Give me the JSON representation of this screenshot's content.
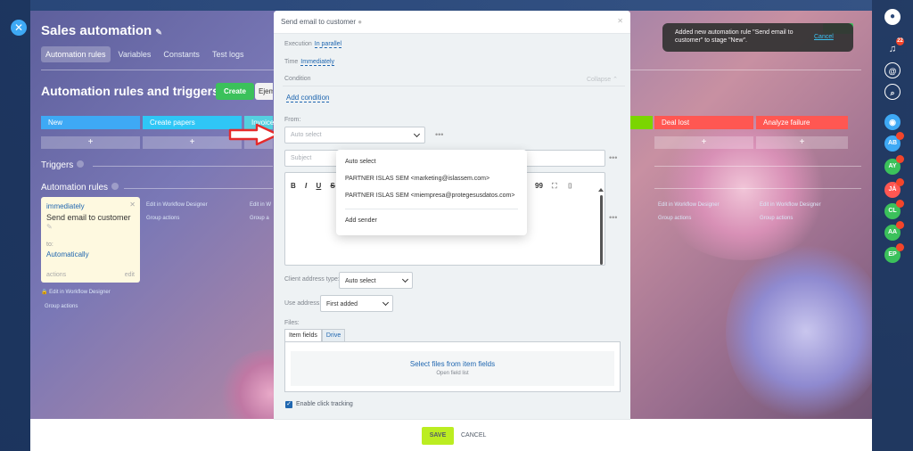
{
  "panel": {
    "title": "Sales automation",
    "tabs": [
      "Automation rules",
      "Variables",
      "Constants",
      "Test logs"
    ],
    "section_title": "Automation rules and triggers",
    "create_label": "Create",
    "ejem_label": "Ejem",
    "stages": [
      {
        "label": "New",
        "color": "#3ea9f5"
      },
      {
        "label": "Create papers",
        "color": "#2fc6f6"
      },
      {
        "label": "Invoice",
        "color": "#55d0e0"
      },
      {
        "label": "",
        "color": "#7bd500"
      },
      {
        "label": "Deal lost",
        "color": "#ff5752"
      },
      {
        "label": "Analyze failure",
        "color": "#ff5752"
      }
    ],
    "plus": "+",
    "triggers_label": "Triggers",
    "rules_label": "Automation rules",
    "rule_card": {
      "when": "immediately",
      "name": "Send email to customer",
      "to_label": "to:",
      "to_value": "Automatically",
      "foot_left": "actions",
      "foot_right": "edit"
    },
    "edit_in_designer": "Edit in Workflow Designer",
    "group_actions": "Group actions"
  },
  "modal": {
    "title": "Send email to customer",
    "execution_label": "Execution",
    "execution_value": "In parallel",
    "time_label": "Time",
    "time_value": "Immediately",
    "condition_label": "Condition",
    "collapse_label": "Collapse",
    "add_condition": "Add condition",
    "from_label": "From:",
    "from_placeholder": "Auto select",
    "subject_placeholder": "Subject",
    "more": "•••",
    "toolbar_buttons": [
      "B",
      "I",
      "U",
      "S"
    ],
    "toolbar_right": [
      "99",
      "⛶",
      "⌷"
    ],
    "client_address_label": "Client address type:",
    "client_address_value": "Auto select",
    "use_address_label": "Use address:",
    "use_address_value": "First added",
    "files_label": "Files:",
    "files_tabs": [
      "Item fields",
      "Drive"
    ],
    "select_files": "Select files from item fields",
    "open_field_list": "Open field list",
    "enable_click_tracking": "Enable click tracking",
    "save_label": "SAVE",
    "cancel_label": "CANCEL"
  },
  "sender_dropdown": {
    "items": [
      "Auto select",
      "PARTNER ISLAS SEM <marketing@islassem.com>",
      "PARTNER ISLAS SEM <miempresa@protegesusdatos.com>"
    ],
    "add_sender": "Add sender"
  },
  "notification": {
    "text": "Added new automation rule \"Send email to customer\" to stage \"New\".",
    "cancel": "Cancel"
  },
  "right_rail": {
    "notification_count": "22",
    "avatars": [
      {
        "initials": "AB",
        "color": "#3ea9f5"
      },
      {
        "initials": "AY",
        "color": "#3bc15b"
      },
      {
        "initials": "JÁ",
        "color": "#ff5752"
      },
      {
        "initials": "CL",
        "color": "#3bc15b"
      },
      {
        "initials": "AA",
        "color": "#3bc15b"
      },
      {
        "initials": "EP",
        "color": "#3bc15b"
      }
    ]
  }
}
